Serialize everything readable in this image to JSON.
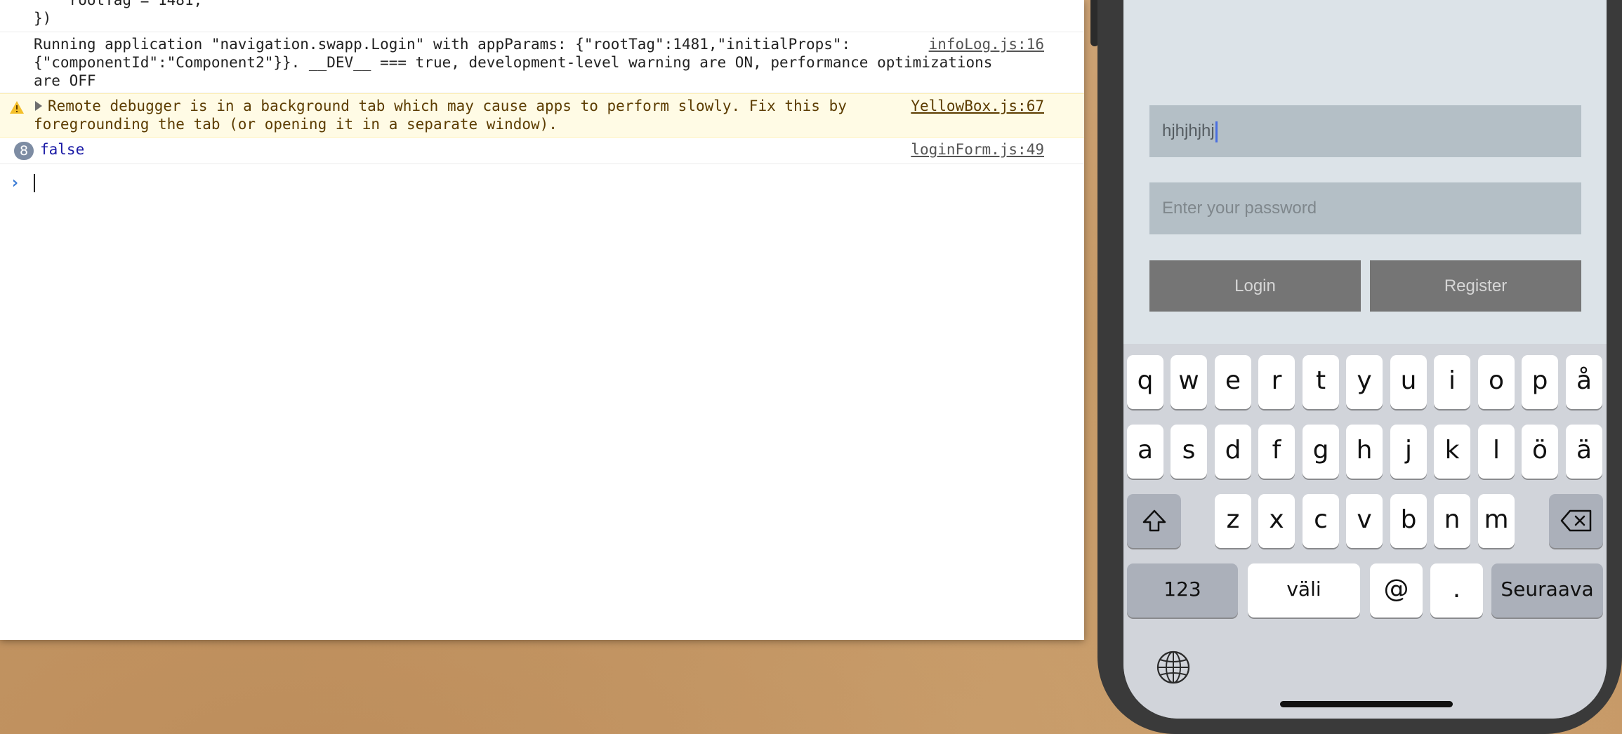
{
  "console": {
    "object_tail": [
      "    rootTag = 1481,",
      "})"
    ],
    "info": {
      "lines": [
        "Running application \"navigation.swapp.Login\" with appParams: {\"rootTag\":1481,\"initialProps\":",
        "{\"componentId\":\"Component2\"}}. __DEV__ === true, development-level warning are ON, performance optimizations",
        "are OFF"
      ],
      "source": "infoLog.js:16"
    },
    "warning": {
      "lines": [
        "Remote debugger is in a background tab which may cause apps to perform slowly. Fix this by",
        "foregrounding the tab (or opening it in a separate window)."
      ],
      "source": "YellowBox.js:67"
    },
    "log": {
      "count": "8",
      "value": "false",
      "source": "loginForm.js:49"
    },
    "prompt_symbol": "›"
  },
  "phone": {
    "username_value": "hjhjhjhj",
    "password_placeholder": "Enter your password",
    "login_label": "Login",
    "register_label": "Register",
    "keyboard": {
      "row1": [
        "q",
        "w",
        "e",
        "r",
        "t",
        "y",
        "u",
        "i",
        "o",
        "p",
        "å"
      ],
      "row2": [
        "a",
        "s",
        "d",
        "f",
        "g",
        "h",
        "j",
        "k",
        "l",
        "ö",
        "ä"
      ],
      "row3": [
        "z",
        "x",
        "c",
        "v",
        "b",
        "n",
        "m"
      ],
      "shift_icon": "shift-arrow-icon",
      "backspace_icon": "backspace-icon",
      "numbers_label": "123",
      "space_label": "väli",
      "at_label": "@",
      "dot_label": ".",
      "next_label": "Seuraava",
      "globe_icon": "globe-icon"
    }
  },
  "colors": {
    "warning_bg": "#fffbe5",
    "input_bg": "#b4bfc6",
    "button_bg": "#757575",
    "caret": "#4a6fe0"
  }
}
